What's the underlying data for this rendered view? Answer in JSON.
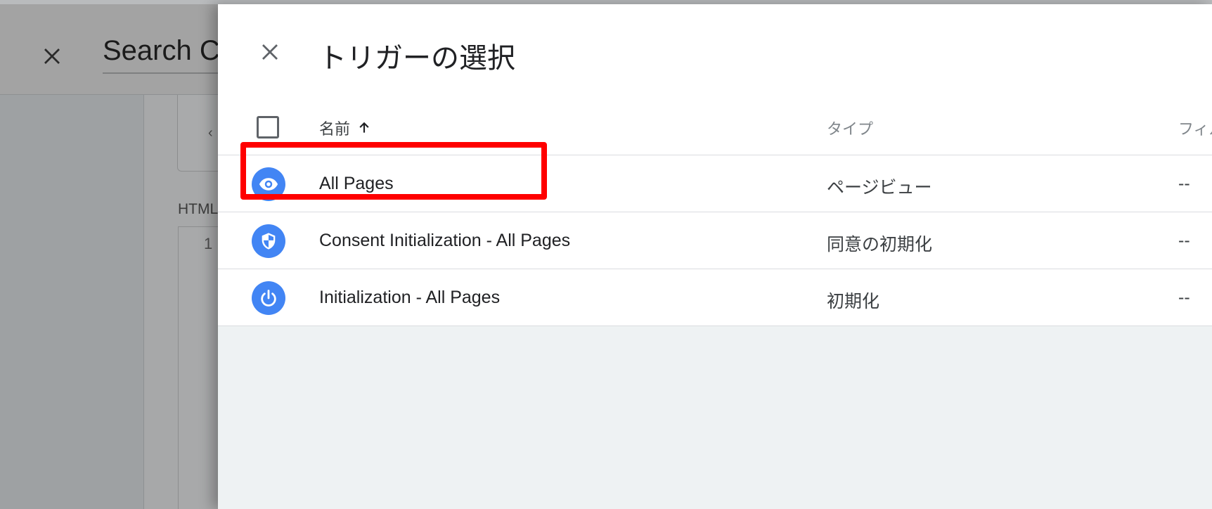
{
  "background": {
    "title": "Search Console",
    "section_label": "HTML",
    "line_number": "1"
  },
  "drawer": {
    "title": "トリガーの選択",
    "columns": {
      "name": "名前",
      "type": "タイプ",
      "filter": "フィルタ"
    },
    "rows": [
      {
        "name": "All Pages",
        "type": "ページビュー",
        "filter": "--",
        "icon": "eye-icon"
      },
      {
        "name": "Consent Initialization - All Pages",
        "type": "同意の初期化",
        "filter": "--",
        "icon": "shield-icon"
      },
      {
        "name": "Initialization - All Pages",
        "type": "初期化",
        "filter": "--",
        "icon": "power-icon"
      }
    ]
  },
  "colors": {
    "accent": "#4285f4",
    "highlight": "#ff0000"
  }
}
